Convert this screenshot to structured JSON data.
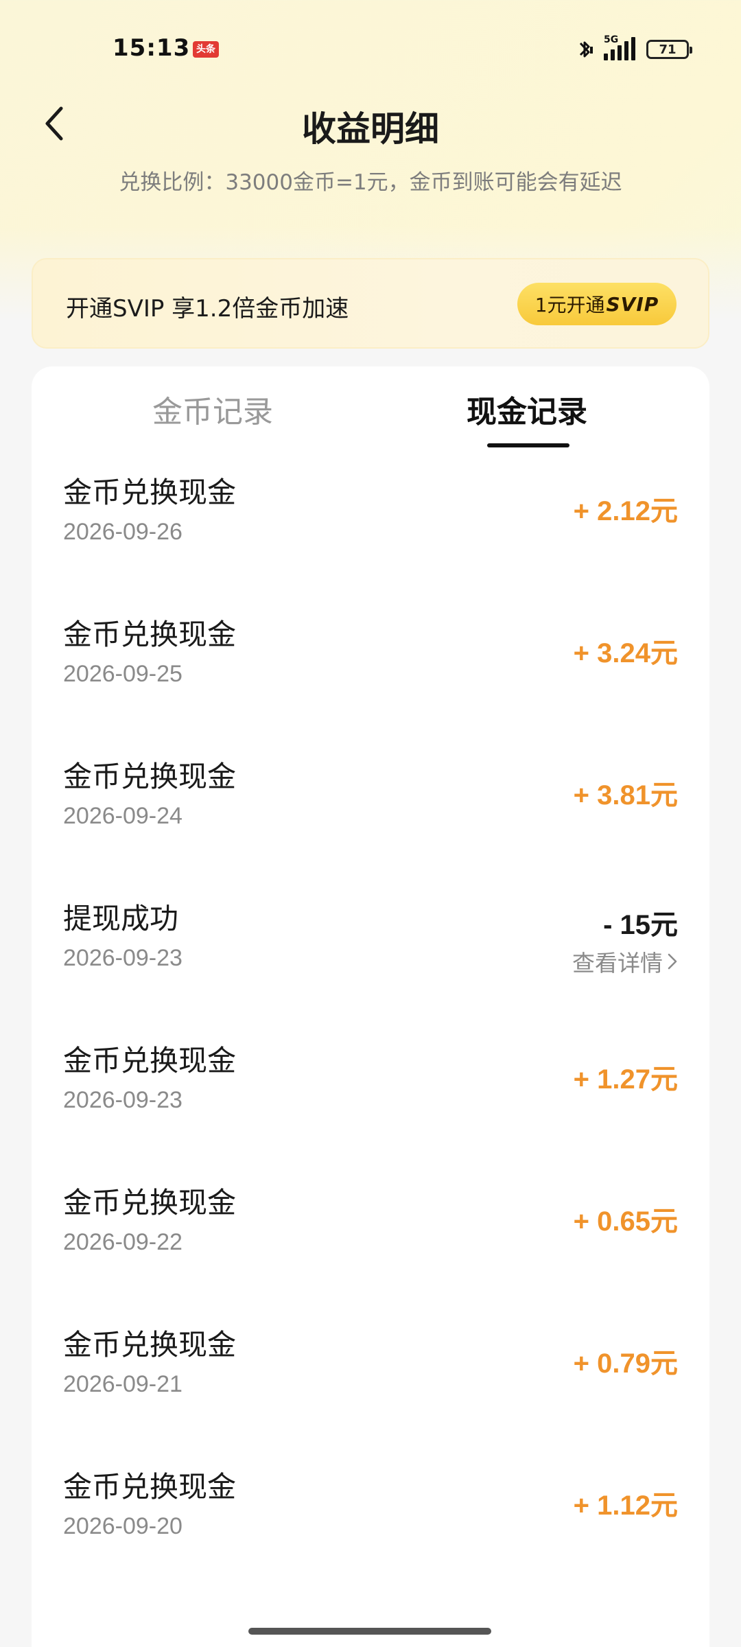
{
  "status_bar": {
    "time": "15:13",
    "app_badge": "头条",
    "network": "5G",
    "battery": "71"
  },
  "header": {
    "title": "收益明细",
    "subtitle": "兑换比例：33000金币=1元，金币到账可能会有延迟"
  },
  "svip": {
    "text": "开通SVIP 享1.2倍金币加速",
    "button_prefix": "1元开通",
    "button_brand": "SVIP"
  },
  "tabs": [
    {
      "label": "金币记录",
      "active": false
    },
    {
      "label": "现金记录",
      "active": true
    }
  ],
  "records": [
    {
      "title": "金币兑换现金",
      "date": "2026-09-26",
      "amount": "+ 2.12",
      "unit": "元",
      "type": "income"
    },
    {
      "title": "金币兑换现金",
      "date": "2026-09-25",
      "amount": "+ 3.24",
      "unit": "元",
      "type": "income"
    },
    {
      "title": "金币兑换现金",
      "date": "2026-09-24",
      "amount": "+ 3.81",
      "unit": "元",
      "type": "income"
    },
    {
      "title": "提现成功",
      "date": "2026-09-23",
      "amount": "- 15",
      "unit": "元",
      "type": "withdraw",
      "detail_link": "查看详情"
    },
    {
      "title": "金币兑换现金",
      "date": "2026-09-23",
      "amount": "+ 1.27",
      "unit": "元",
      "type": "income"
    },
    {
      "title": "金币兑换现金",
      "date": "2026-09-22",
      "amount": "+ 0.65",
      "unit": "元",
      "type": "income"
    },
    {
      "title": "金币兑换现金",
      "date": "2026-09-21",
      "amount": "+ 0.79",
      "unit": "元",
      "type": "income"
    },
    {
      "title": "金币兑换现金",
      "date": "2026-09-20",
      "amount": "+ 1.12",
      "unit": "元",
      "type": "income"
    }
  ],
  "colors": {
    "income": "#f0932b",
    "svip_button": "#f8c93b",
    "text_primary": "#1a1a1a",
    "text_secondary": "#8a8a8a"
  }
}
